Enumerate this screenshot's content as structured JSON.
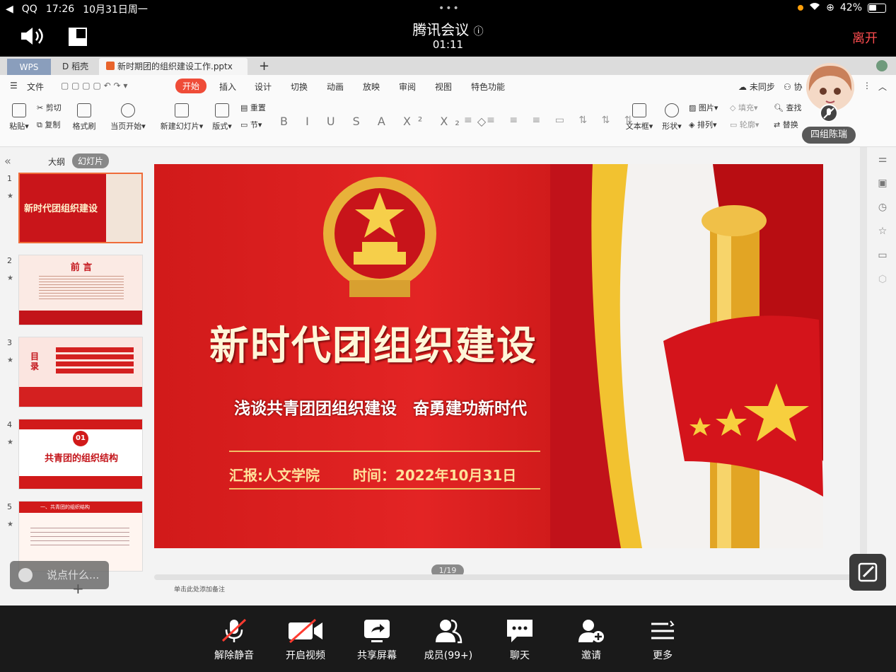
{
  "status": {
    "carrier": "QQ",
    "time": "17:26",
    "date": "10月31日周一",
    "battery": "42%"
  },
  "meeting": {
    "title": "腾讯会议",
    "timer": "01:11",
    "leave_label": "离开"
  },
  "wps": {
    "tabs": {
      "wps": "WPS",
      "daoke": "稻壳",
      "doc": "新时期团的组织建设工作.pptx",
      "add": "+"
    },
    "menu": {
      "file": "文件",
      "start": "开始",
      "insert": "插入",
      "design": "设计",
      "switch": "切换",
      "animation": "动画",
      "play": "放映",
      "review": "审阅",
      "view": "视图",
      "special": "特色功能",
      "sync": "未同步",
      "collab": "协"
    },
    "ribbon": {
      "cut": "剪切",
      "copy": "复制",
      "paste": "粘贴",
      "format_painter": "格式刷",
      "current_start": "当页开始",
      "new_slide": "新建幻灯片",
      "layout": "版式",
      "section": "节",
      "reset": "重置",
      "textbox": "文本框",
      "shape": "形状",
      "picture": "图片",
      "arrange": "排列",
      "fill": "填充",
      "outline": "轮廓",
      "find": "查找",
      "replace": "替换"
    },
    "left_panel": {
      "outline_tab": "大纲",
      "slides_tab": "幻灯片",
      "slide_numbers": [
        "1",
        "2",
        "3",
        "4",
        "5"
      ]
    },
    "thumbs": {
      "t1": "新时代团组织建设",
      "t2": "前 言",
      "t3": "目 录",
      "t4_num": "01",
      "t4_title": "共青团的组织结构",
      "t5_title": "一、共青团的组织结构"
    },
    "slide": {
      "title": "新时代团组织建设",
      "subtitle": "浅谈共青团团组织建设　奋勇建功新时代",
      "reporter": "汇报:人文学院",
      "time": "时间：2022年10月31日"
    },
    "pager": "1/19",
    "notes_placeholder": "单击此处添加备注"
  },
  "chat_placeholder": "说点什么...",
  "participant": {
    "name": "四组陈瑞"
  },
  "toolbar": {
    "unmute": "解除静音",
    "video": "开启视频",
    "share": "共享屏幕",
    "members": "成员(99+)",
    "chat": "聊天",
    "invite": "邀请",
    "more": "更多"
  },
  "colors": {
    "accent_red": "#ef4c38",
    "slide_red": "#d11a1a",
    "gold": "#f1c067",
    "leave_red": "#ff4d4f"
  }
}
